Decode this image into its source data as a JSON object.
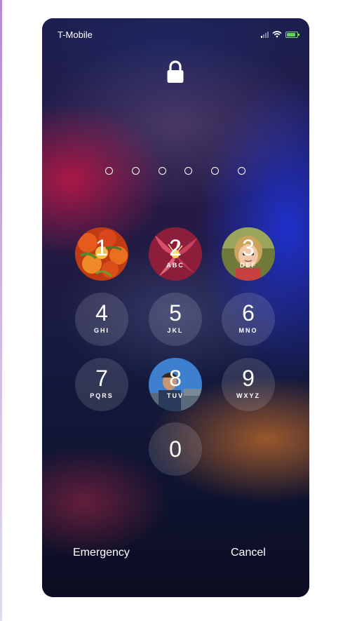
{
  "status_bar": {
    "carrier": "T-Mobile",
    "signal_bars_active": 1,
    "icons": [
      "cellular-signal-icon",
      "wifi-icon",
      "battery-charging-icon"
    ],
    "battery_color": "#5fd35a"
  },
  "lock_icon": "lock-icon",
  "passcode": {
    "length": 6,
    "entered": 0
  },
  "keypad": [
    {
      "digit": "1",
      "letters": "",
      "photo": "tomatoes"
    },
    {
      "digit": "2",
      "letters": "ABC",
      "photo": "lily-flower"
    },
    {
      "digit": "3",
      "letters": "DEF",
      "photo": "child-portrait"
    },
    {
      "digit": "4",
      "letters": "GHI"
    },
    {
      "digit": "5",
      "letters": "JKL"
    },
    {
      "digit": "6",
      "letters": "MNO"
    },
    {
      "digit": "7",
      "letters": "PQRS"
    },
    {
      "digit": "8",
      "letters": "TUV",
      "photo": "person-blue-sky"
    },
    {
      "digit": "9",
      "letters": "WXYZ"
    },
    {
      "digit": "0",
      "letters": ""
    }
  ],
  "bottom": {
    "emergency_label": "Emergency",
    "cancel_label": "Cancel"
  },
  "colors": {
    "text": "#ffffff",
    "key_background": "rgba(255,255,255,0.13)"
  }
}
